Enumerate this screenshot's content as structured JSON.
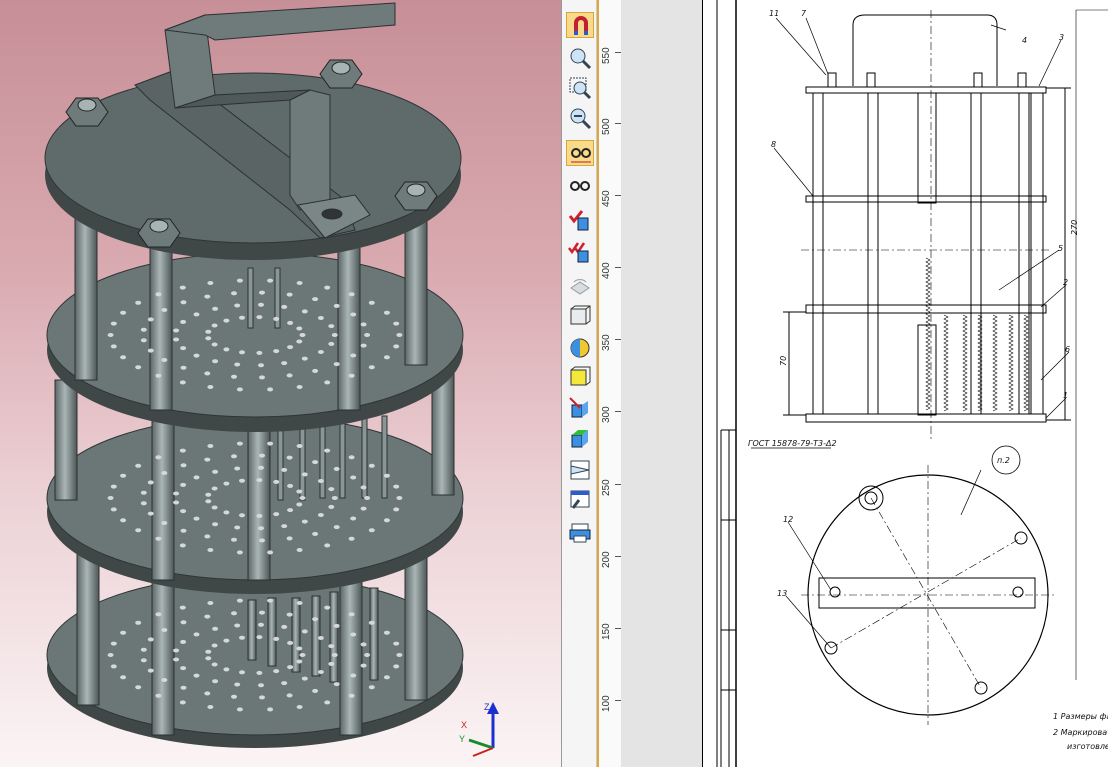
{
  "toolbar": {
    "buttons": [
      {
        "icon": "magnet-icon",
        "active": true
      },
      {
        "icon": "zoom-in-icon"
      },
      {
        "icon": "zoom-window-icon"
      },
      {
        "icon": "zoom-out-icon"
      },
      {
        "icon": "glasses-select-icon",
        "active": true
      },
      {
        "icon": "glasses-icon"
      },
      {
        "icon": "check-cube-icon"
      },
      {
        "icon": "double-check-cube-icon"
      },
      {
        "icon": "rotate-plane-icon"
      },
      {
        "icon": "wireframe-cube-icon"
      },
      {
        "icon": "sphere-shade-icon"
      },
      {
        "icon": "yellow-face-icon"
      },
      {
        "icon": "section-cube-icon"
      },
      {
        "icon": "green-face-cube-icon"
      },
      {
        "icon": "projection-icon"
      },
      {
        "icon": "tool-window-icon"
      },
      {
        "icon": "print-dialog-icon"
      }
    ]
  },
  "ruler": {
    "labels": [
      "550",
      "500",
      "450",
      "400",
      "350",
      "300",
      "250",
      "200",
      "150",
      "100"
    ]
  },
  "axes": {
    "x": "X",
    "y": "Y",
    "z": "Z"
  },
  "drawing": {
    "callouts": [
      "11",
      "7",
      "4",
      "3",
      "8",
      "5",
      "2",
      "6",
      "1",
      "12",
      "13"
    ],
    "dims": {
      "height": "270",
      "lower": "70"
    },
    "standard": "ГОСТ 15878-79-Т3-Δ2",
    "circle_label": "п.2",
    "notes": [
      "1  Размеры фа",
      "2  Маркировать",
      "изготовлен"
    ]
  },
  "colors": {
    "model": "#5f6a6a",
    "model_dark": "#3e4646",
    "model_light": "#8a9696",
    "accent": "#e2a73a"
  }
}
